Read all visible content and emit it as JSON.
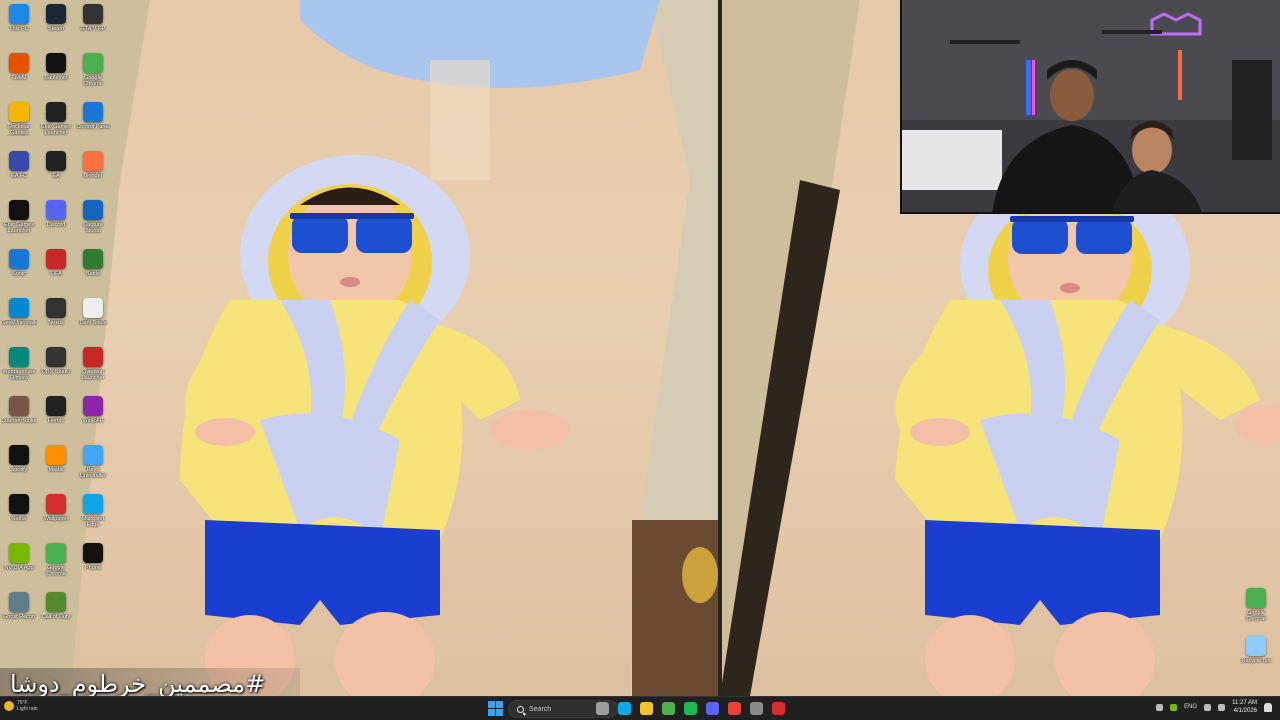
{
  "desktop": {
    "icons_left": [
      {
        "label": "This PC",
        "icon": "monitor-icon",
        "color": "#1e88e5"
      },
      {
        "label": "Steam",
        "icon": "steam-icon",
        "color": "#1b2838"
      },
      {
        "label": "GTA V RP",
        "icon": "game-icon",
        "color": "#333333"
      },
      {
        "label": "FiveM",
        "icon": "fivem-icon",
        "color": "#e65100"
      },
      {
        "label": "Battle.net",
        "icon": "battlenet-icon",
        "color": "#111111"
      },
      {
        "label": "Google Chrome",
        "icon": "chrome-icon",
        "color": "#4caf50"
      },
      {
        "label": "Rockstar Games Launcher",
        "icon": "rockstar-icon",
        "color": "#f4b400"
      },
      {
        "label": "Epic Games Launcher",
        "icon": "epic-icon",
        "color": "#222222"
      },
      {
        "label": "Control Panel",
        "icon": "control-panel-icon",
        "color": "#1976d2"
      },
      {
        "label": "EA FC",
        "icon": "game-icon",
        "color": "#3949ab"
      },
      {
        "label": "EA",
        "icon": "ea-icon",
        "color": "#222222"
      },
      {
        "label": "Blender",
        "icon": "blender-icon",
        "color": "#ff7043"
      },
      {
        "label": "Epic Games Launcher",
        "icon": "epic-icon",
        "color": "#111111"
      },
      {
        "label": "Discord",
        "icon": "discord-icon",
        "color": "#5865f2"
      },
      {
        "label": "Capture Studio",
        "icon": "capture-icon",
        "color": "#1565c0"
      },
      {
        "label": "Sonic",
        "icon": "game-icon",
        "color": "#1976d2"
      },
      {
        "label": "FIFA",
        "icon": "game-icon",
        "color": "#c62828"
      },
      {
        "label": "Battle",
        "icon": "game-icon",
        "color": "#2e7d32"
      },
      {
        "label": "GeekUninstaller",
        "icon": "app-icon",
        "color": "#0288d1"
      },
      {
        "label": "Nexus",
        "icon": "app-icon",
        "color": "#333333"
      },
      {
        "label": "Dark Souls",
        "icon": "document-icon",
        "color": "#eeeeee"
      },
      {
        "label": "Wondershare Filmora",
        "icon": "filmora-icon",
        "color": "#00897b"
      },
      {
        "label": "OBS Studio",
        "icon": "obs-icon",
        "color": "#333333"
      },
      {
        "label": "Overwolf Launcher",
        "icon": "overwolf-icon",
        "color": "#c62828"
      },
      {
        "label": "Counter-Strike",
        "icon": "game-icon",
        "color": "#795548"
      },
      {
        "label": "Heroic",
        "icon": "app-icon",
        "color": "#222222"
      },
      {
        "label": "WinRAR",
        "icon": "winrar-icon",
        "color": "#8e24aa"
      },
      {
        "label": "Spotify",
        "icon": "app-icon",
        "color": "#111111"
      },
      {
        "label": "Medal",
        "icon": "medal-icon",
        "color": "#ff8f00"
      },
      {
        "label": "Revo Uninstaller",
        "icon": "app-icon",
        "color": "#42a5f5"
      },
      {
        "label": "Netflix",
        "icon": "app-icon",
        "color": "#111111"
      },
      {
        "label": "Wallpaper",
        "icon": "app-icon",
        "color": "#d32f2f"
      },
      {
        "label": "Microsoft Edge",
        "icon": "edge-icon",
        "color": "#0ea5e9"
      },
      {
        "label": "NVIDIA App",
        "icon": "nvidia-icon",
        "color": "#76b900"
      },
      {
        "label": "Google Chrome",
        "icon": "chrome-icon",
        "color": "#4caf50"
      },
      {
        "label": "Phone",
        "icon": "phone-icon",
        "color": "#111111"
      },
      {
        "label": "Ghost Recon",
        "icon": "game-icon",
        "color": "#607d8b"
      },
      {
        "label": "Call of Duty",
        "icon": "game-icon",
        "color": "#558b2f"
      }
    ],
    "icons_right": [
      {
        "label": "Google Chrome",
        "icon": "chrome-icon",
        "color": "#4caf50"
      },
      {
        "label": "Recycle Bin",
        "icon": "recycle-bin-icon",
        "color": "#90caf9"
      }
    ]
  },
  "caption": {
    "text": "#مصممين_خرطوم_دوشا"
  },
  "taskbar": {
    "weather_temp": "75°F",
    "weather_desc": "Light rain",
    "search_placeholder": "Search",
    "pinned_apps": [
      {
        "name": "task-view",
        "color": "#9e9e9e"
      },
      {
        "name": "edge",
        "color": "#0ea5e9"
      },
      {
        "name": "file-explorer",
        "color": "#f4c430"
      },
      {
        "name": "chrome",
        "color": "#4caf50"
      },
      {
        "name": "spotify",
        "color": "#1db954"
      },
      {
        "name": "discord",
        "color": "#5865f2"
      },
      {
        "name": "chrome-profile",
        "color": "#ea4335"
      },
      {
        "name": "settings",
        "color": "#8a8a8a"
      },
      {
        "name": "acrobat",
        "color": "#d32f2f"
      }
    ],
    "language": "ENG",
    "time": "11:27 AM",
    "date": "4/1/2026"
  },
  "colors": {
    "robe_yellow": "#f6e37a",
    "robe_trim": "#c9d0f0",
    "sunglasses": "#1f4fd1",
    "shorts": "#1a3fd0",
    "sand": "#e6c9a8",
    "wicker": "#cfc4a8"
  }
}
